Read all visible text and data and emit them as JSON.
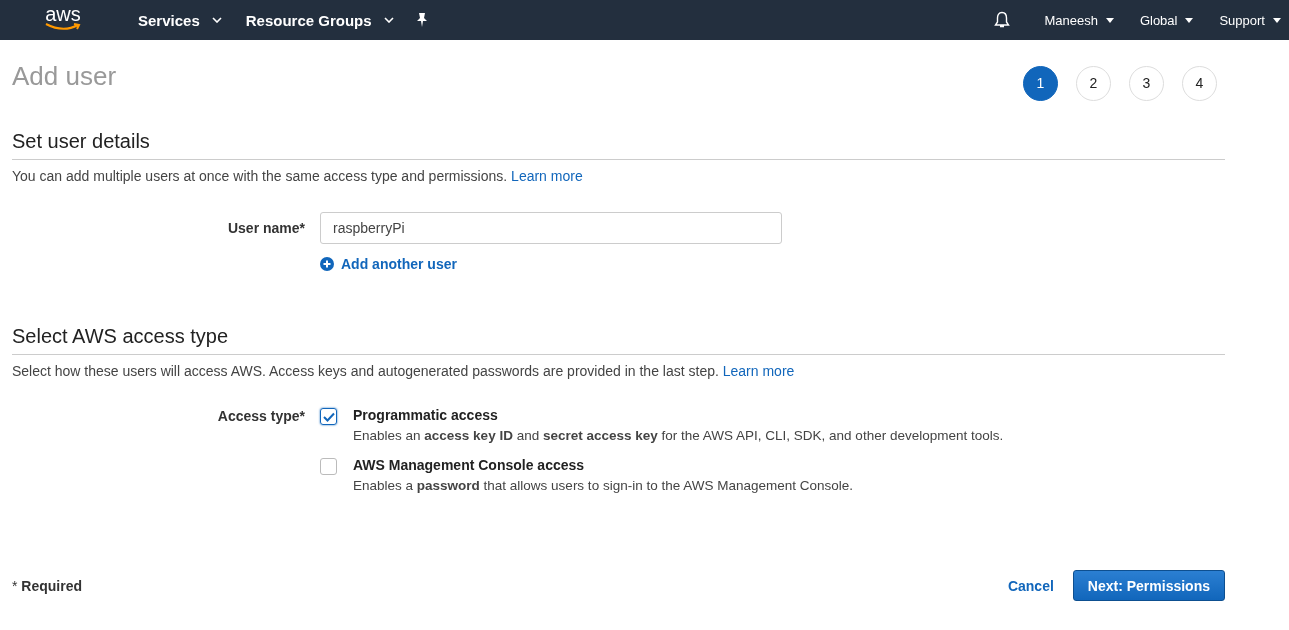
{
  "nav": {
    "logo": "aws",
    "menus": [
      {
        "label": "Services"
      },
      {
        "label": "Resource Groups"
      }
    ],
    "right_menus": [
      {
        "label": "Maneesh"
      },
      {
        "label": "Global"
      },
      {
        "label": "Support"
      }
    ]
  },
  "page_title": "Add user",
  "steps": [
    {
      "label": "1",
      "selected": true
    },
    {
      "label": "2",
      "selected": false
    },
    {
      "label": "3",
      "selected": false
    },
    {
      "label": "4",
      "selected": false
    }
  ],
  "details": {
    "heading": "Set user details",
    "description": "You can add multiple users at once with the same access type and permissions.",
    "link": "Learn more",
    "field_label": "User name*",
    "value": "raspberryPi",
    "add_link": "Add another user"
  },
  "access": {
    "heading": "Select AWS access type",
    "description": "Select how these users will access AWS. Access keys and autogenerated passwords are provided in the last step.",
    "link": "Learn more",
    "field_label": "Access type*",
    "options": [
      {
        "label": "Programmatic access",
        "description": "Enables an **access key ID** and **secret access key** for the AWS API, CLI, SDK, and other development tools.",
        "checked": true
      },
      {
        "label": "AWS Management Console access",
        "description": "Enables a **password** that allows users to sign-in to the AWS Management Console.",
        "checked": false
      }
    ]
  },
  "footer": {
    "required_note": "* **Required**",
    "cancel": "Cancel",
    "next": "Next: Permissions"
  }
}
